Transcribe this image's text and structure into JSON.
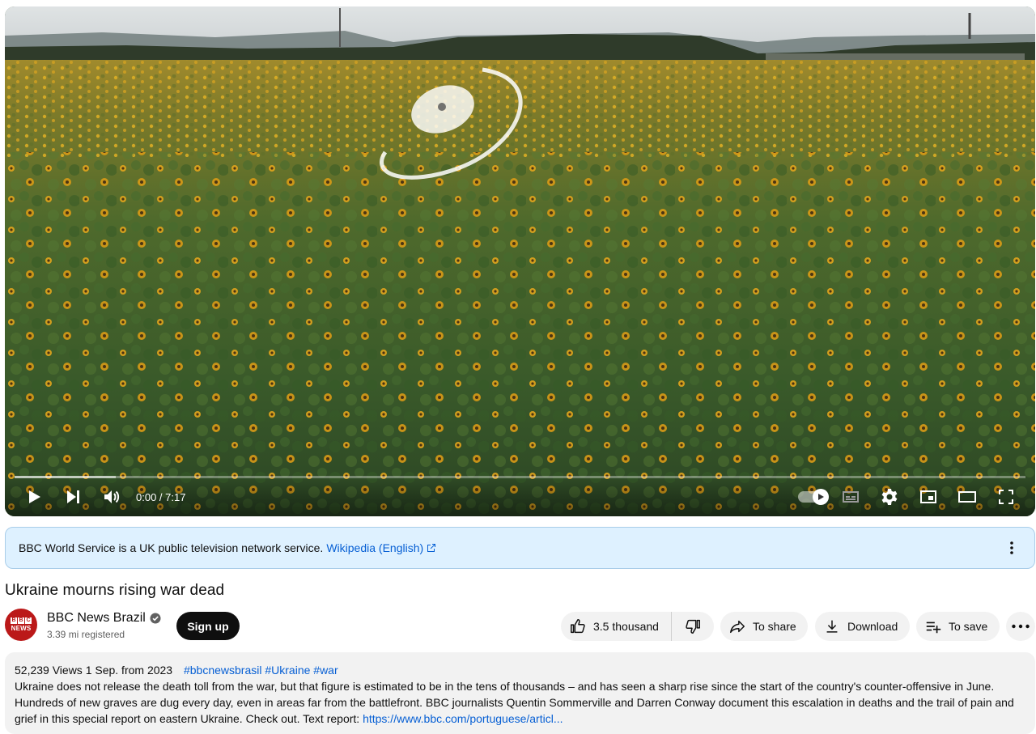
{
  "player": {
    "time": "0:00 / 7:17",
    "progress_fraction": 0,
    "buffered_fraction": 0.1,
    "autoplay_on": true
  },
  "info_panel": {
    "text": "BBC World Service is a UK public television network service.",
    "link": "Wikipedia (English)",
    "link_icon": "external-link-icon"
  },
  "video": {
    "title": "Ukraine mourns rising war dead"
  },
  "channel": {
    "name": "BBC News Brazil",
    "subscribers": "3.39 mi registered",
    "verified": true,
    "avatar_top": "BBC",
    "avatar_bottom": "NEWS",
    "signup_label": "Sign up"
  },
  "actions": {
    "like_count": "3.5 thousand",
    "share_label": "To share",
    "download_label": "Download",
    "save_label": "To save"
  },
  "description": {
    "meta": "52,239 Views 1 Sep. from 2023",
    "tags": "#bbcnewsbrasil #Ukraine #war",
    "body": "Ukraine does not release the death toll from the war, but that figure is estimated to be in the tens of thousands – and has seen a sharp rise since the start of the country's counter-offensive in June. Hundreds of new graves are dug every day, even in areas far from the battlefront. BBC journalists Quentin Sommerville and Darren Conway document this escalation in deaths and the trail of pain and grief in this special report on eastern Ukraine. Check out. Text report: ",
    "url": "https://www.bbc.com/portuguese/articl..."
  },
  "colors": {
    "accent_link": "#065fd4",
    "info_bg": "#def1ff",
    "bbc_red": "#bb1919"
  }
}
